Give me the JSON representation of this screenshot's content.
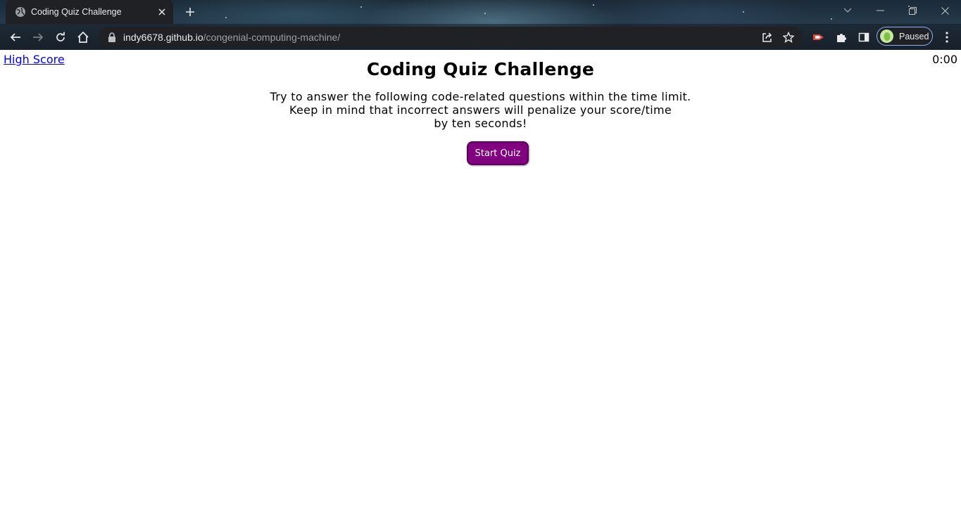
{
  "browser": {
    "tab": {
      "title": "Coding Quiz Challenge",
      "favicon": "globe-icon"
    },
    "address_bar": {
      "host": "indy6678.github.io",
      "path": "/congenial-computing-machine/"
    },
    "profile": {
      "label": "Paused"
    }
  },
  "page": {
    "high_score_link": "High Score",
    "timer": "0:00",
    "title": "Coding Quiz Challenge",
    "intro_lines": [
      "Try to answer the following code-related questions within the time limit.",
      "Keep in mind that incorrect answers will penalize your score/time",
      "by ten seconds!"
    ],
    "start_button": "Start Quiz"
  },
  "colors": {
    "button_bg": "#800080",
    "link": "#0000ee",
    "chrome_tab": "#202124"
  }
}
